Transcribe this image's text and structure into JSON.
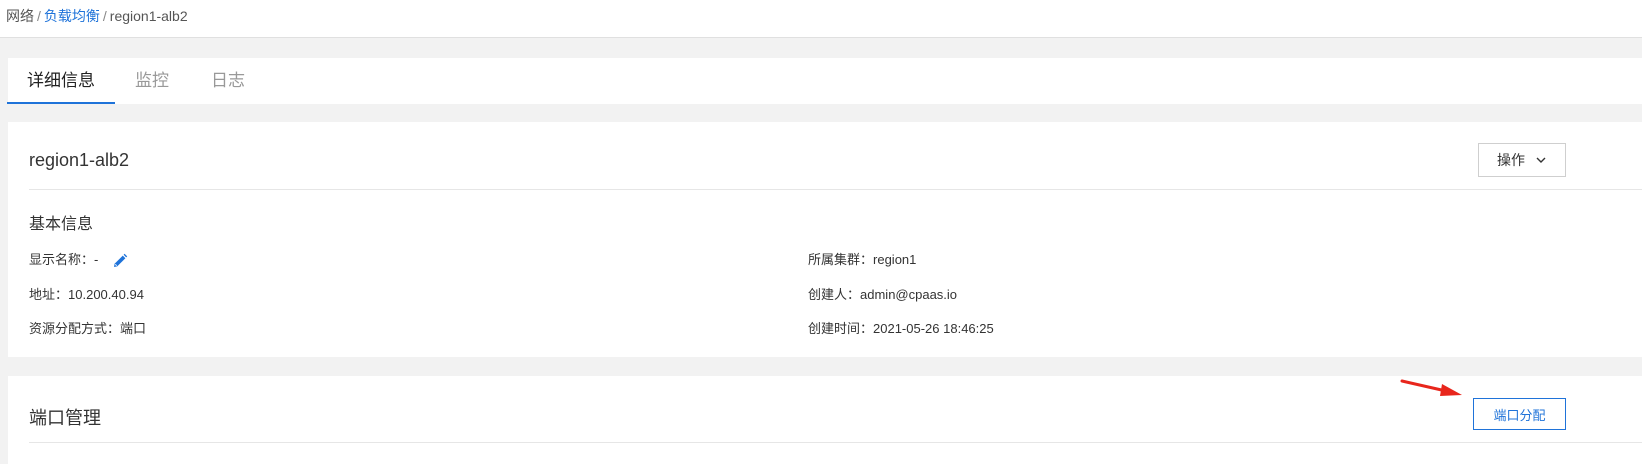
{
  "breadcrumb": {
    "root": "网络",
    "sep1": "/",
    "parent": "负载均衡",
    "sep2": "/",
    "current": "region1-alb2"
  },
  "tabs": [
    {
      "label": "详细信息",
      "active": true
    },
    {
      "label": "监控",
      "active": false
    },
    {
      "label": "日志",
      "active": false
    }
  ],
  "detail": {
    "title": "region1-alb2",
    "actions_label": "操作",
    "section_title": "基本信息",
    "display_name": {
      "key": "显示名称：",
      "value": "-"
    },
    "cluster": {
      "key": "所属集群：",
      "value": "region1"
    },
    "address": {
      "key": "地址：",
      "value": "10.200.40.94"
    },
    "creator": {
      "key": "创建人：",
      "value": "admin@cpaas.io"
    },
    "alloc_mode": {
      "key": "资源分配方式：",
      "value": "端口"
    },
    "created_at": {
      "key": "创建时间：",
      "value": "2021-05-26 18:46:25"
    }
  },
  "ports": {
    "title": "端口管理",
    "allocate_label": "端口分配"
  },
  "colors": {
    "accent": "#1f73d9",
    "annotation_arrow": "#e8261c",
    "page_bg": "#f2f2f2"
  }
}
